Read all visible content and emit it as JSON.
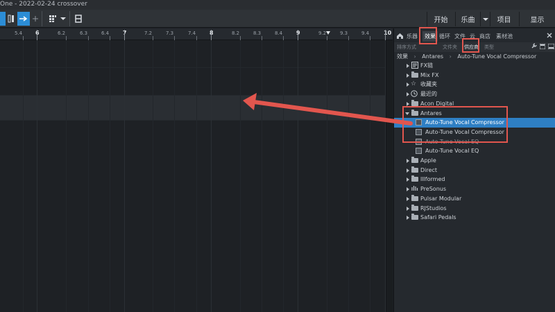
{
  "window": {
    "title": "One - 2022-02-24 crossover"
  },
  "toolbar": {
    "right_buttons": [
      {
        "label": "开始"
      },
      {
        "label": "乐曲"
      },
      {
        "label": "项目"
      },
      {
        "label": "显示"
      }
    ]
  },
  "ruler": {
    "ticks": [
      "5.4",
      "6",
      "6.2",
      "6.3",
      "6.4",
      "7",
      "7.2",
      "7.3",
      "7.4",
      "8",
      "8.2",
      "8.3",
      "8.4",
      "9",
      "9.2",
      "9.3",
      "9.4",
      "10"
    ]
  },
  "browser": {
    "tabs": [
      "乐器",
      "效果",
      "循环",
      "文件",
      "云",
      "商店",
      "素材池"
    ],
    "active_tab": "效果",
    "filters": [
      "排序方式",
      "文件夹",
      "供应商",
      "类型"
    ],
    "active_filter": "供应商",
    "breadcrumb": {
      "root": "效果",
      "vendor": "Antares",
      "item": "Auto-Tune Vocal Compressor"
    },
    "tree": {
      "fx_chain": "FX链",
      "mix_fx": "Mix FX",
      "favorites": "收藏夹",
      "recent": "最近的",
      "acon": "Acon Digital",
      "antares": "Antares",
      "plugin1": "Auto-Tune Vocal Compressor",
      "plugin2": "Auto-Tune Vocal Compressor",
      "plugin3": "Auto-Tune Vocal EQ",
      "plugin4": "Auto-Tune Vocal EQ",
      "apple": "Apple",
      "direct": "Direct",
      "illformed": "Illformed",
      "presonus": "PreSonus",
      "pulsar": "Pulsar Modular",
      "rjstudios": "RJStudios",
      "safari": "Safari Pedals"
    }
  },
  "colors": {
    "accent": "#2c8dd6",
    "selection": "#2e7fc4",
    "annotation": "#e2564e"
  }
}
